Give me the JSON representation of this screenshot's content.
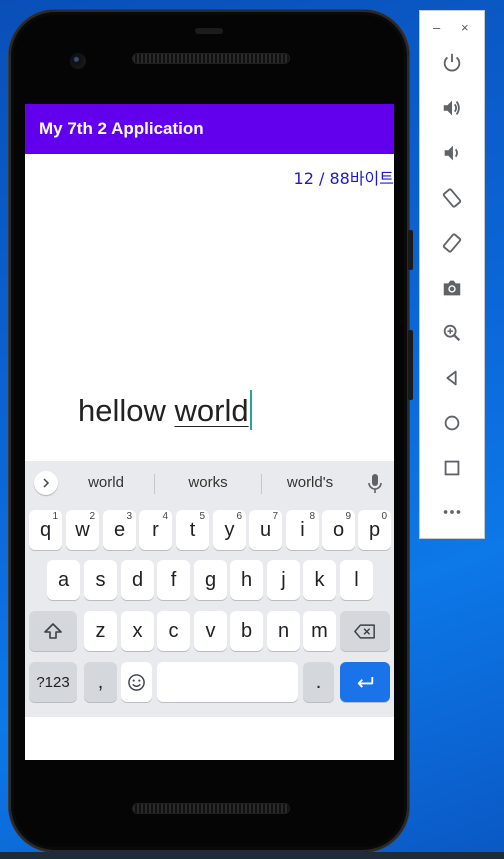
{
  "app": {
    "title": "My 7th 2 Application"
  },
  "counter": {
    "text": "12 / 88바이트"
  },
  "editor": {
    "plain_text": "hellow ",
    "composing_text": "world"
  },
  "suggestions": [
    "world",
    "works",
    "world's"
  ],
  "keyboard": {
    "row1": [
      {
        "key": "q",
        "hint": "1"
      },
      {
        "key": "w",
        "hint": "2"
      },
      {
        "key": "e",
        "hint": "3"
      },
      {
        "key": "r",
        "hint": "4"
      },
      {
        "key": "t",
        "hint": "5"
      },
      {
        "key": "y",
        "hint": "6"
      },
      {
        "key": "u",
        "hint": "7"
      },
      {
        "key": "i",
        "hint": "8"
      },
      {
        "key": "o",
        "hint": "9"
      },
      {
        "key": "p",
        "hint": "0"
      }
    ],
    "row2": [
      "a",
      "s",
      "d",
      "f",
      "g",
      "h",
      "j",
      "k",
      "l"
    ],
    "row3": [
      "z",
      "x",
      "c",
      "v",
      "b",
      "n",
      "m"
    ],
    "symbols_label": "?123",
    "comma_label": ",",
    "period_label": ".",
    "enter_label": "↵"
  },
  "toolbar": {
    "minimize_label": "–",
    "close_label": "×",
    "buttons": [
      "power-icon",
      "volume-up-icon",
      "volume-down-icon",
      "rotate-left-icon",
      "rotate-right-icon",
      "camera-icon",
      "zoom-icon",
      "back-icon",
      "home-icon",
      "overview-icon",
      "more-icon"
    ]
  },
  "colors": {
    "app_bar": "#6200ee",
    "counter_text": "#1a1ad6",
    "enter_key": "#1a73e8",
    "cursor": "#26a69a"
  }
}
